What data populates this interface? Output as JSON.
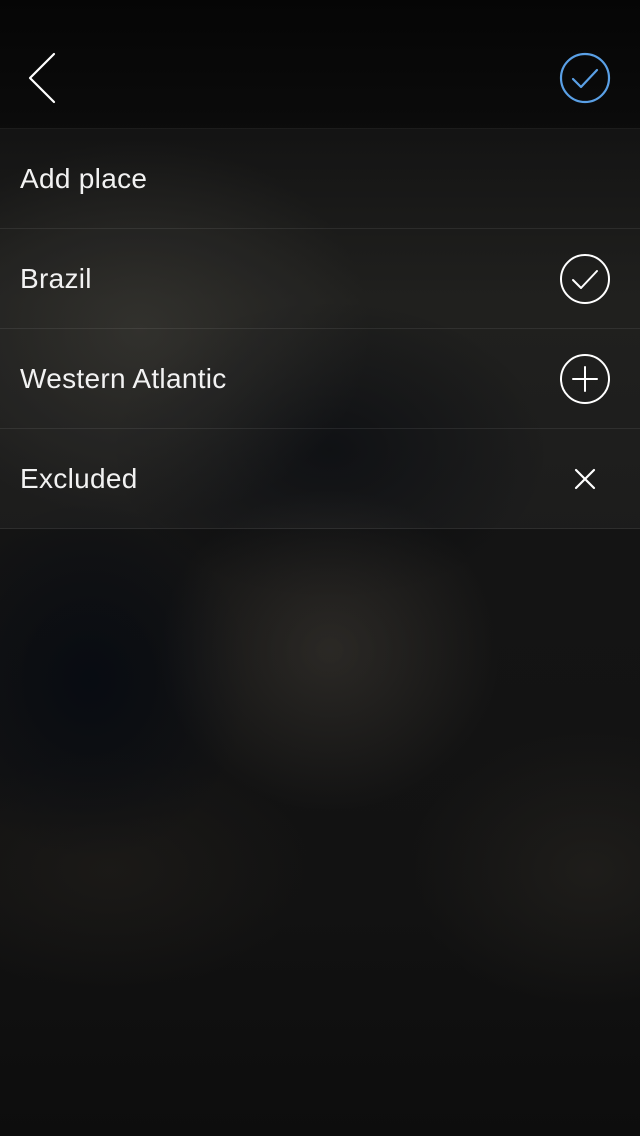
{
  "colors": {
    "accent": "#5aa0e6",
    "text": "#f2f2f2",
    "icon": "#ffffff"
  },
  "header": {
    "back_icon": "chevron-left-icon",
    "confirm_icon": "check-circle-icon"
  },
  "list": {
    "items": [
      {
        "label": "Add place",
        "icon": null
      },
      {
        "label": "Brazil",
        "icon": "check-circle-icon"
      },
      {
        "label": "Western Atlantic",
        "icon": "plus-circle-icon"
      },
      {
        "label": "Excluded",
        "icon": "close-icon"
      }
    ]
  }
}
